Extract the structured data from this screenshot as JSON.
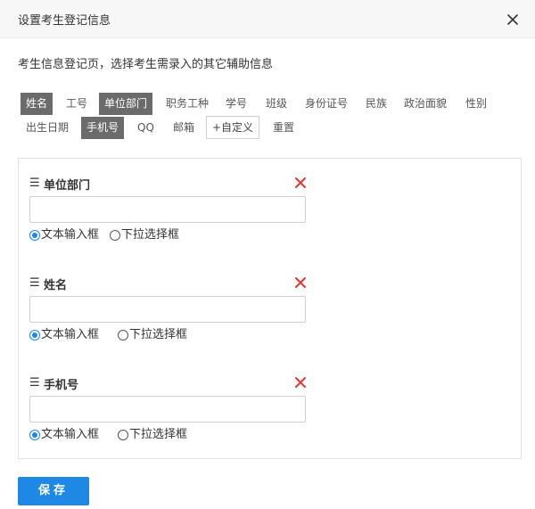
{
  "dialog": {
    "title": "设置考生登记信息",
    "close_icon": "close-icon",
    "description": "考生信息登记页，选择考生需录入的其它辅助信息"
  },
  "tags": {
    "row1": [
      {
        "label": "姓名",
        "selected": true
      },
      {
        "label": "工号",
        "selected": false
      },
      {
        "label": "单位部门",
        "selected": true
      },
      {
        "label": "职务工种",
        "selected": false
      },
      {
        "label": "学号",
        "selected": false
      },
      {
        "label": "班级",
        "selected": false
      },
      {
        "label": "身份证号",
        "selected": false
      },
      {
        "label": "民族",
        "selected": false
      },
      {
        "label": "政治面貌",
        "selected": false
      },
      {
        "label": "性别",
        "selected": false
      }
    ],
    "row2": [
      {
        "label": "出生日期",
        "selected": false
      },
      {
        "label": "手机号",
        "selected": true
      },
      {
        "label": "QQ",
        "selected": false
      },
      {
        "label": "邮箱",
        "selected": false
      },
      {
        "label": "+自定义",
        "selected": false
      },
      {
        "label": "重置",
        "selected": false
      }
    ]
  },
  "fields": [
    {
      "drag_icon": "☰",
      "label": "单位部门",
      "value": "",
      "options": [
        "文本输入框",
        "下拉选择框"
      ],
      "selected": 0
    },
    {
      "drag_icon": "☰",
      "label": "姓名",
      "value": "",
      "options": [
        "文本输入框",
        "下拉选择框"
      ],
      "selected": 0
    },
    {
      "drag_icon": "☰",
      "label": "手机号",
      "value": "",
      "options": [
        "文本输入框",
        "下拉选择框"
      ],
      "selected": 0
    }
  ],
  "colors": {
    "primary": "#1e88e5",
    "selected_tag": "#6b6b6b",
    "delete": "#e53935"
  },
  "save_label": "保存"
}
